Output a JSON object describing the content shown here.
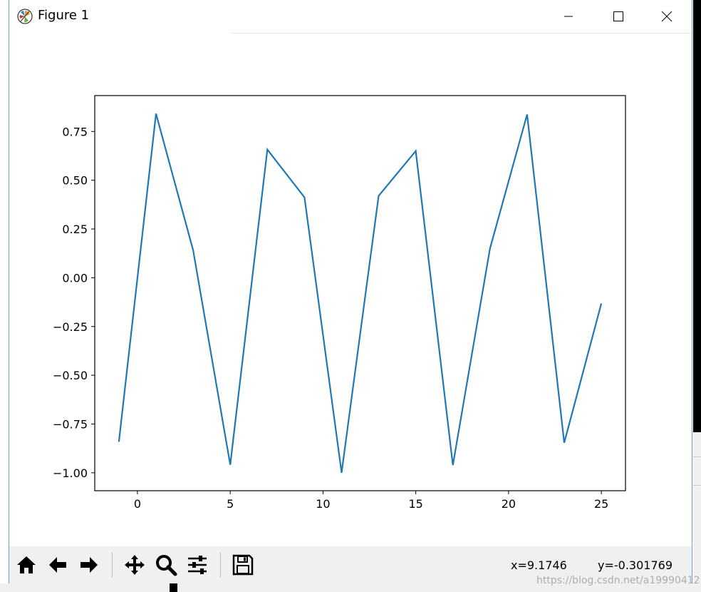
{
  "window": {
    "title": "Figure 1",
    "icons": {
      "app": "matplotlib-icon",
      "minimize": "minimize-icon",
      "maximize": "maximize-icon",
      "close": "close-icon"
    }
  },
  "toolbar": {
    "buttons": [
      {
        "name": "home",
        "icon": "home-icon"
      },
      {
        "name": "back",
        "icon": "arrow-left-icon"
      },
      {
        "name": "forward",
        "icon": "arrow-right-icon"
      },
      {
        "name": "pan",
        "icon": "move-icon"
      },
      {
        "name": "zoom",
        "icon": "zoom-icon"
      },
      {
        "name": "configure-subplots",
        "icon": "sliders-icon"
      },
      {
        "name": "save",
        "icon": "save-icon"
      }
    ],
    "x_readout": "x=9.1746",
    "y_readout": "y=-0.301769"
  },
  "watermark": "https://blog.csdn.net/a19990412",
  "chart_data": {
    "type": "line",
    "title": "",
    "xlabel": "",
    "ylabel": "",
    "xlim": [
      -2.3,
      26.3
    ],
    "ylim": [
      -1.092,
      0.934
    ],
    "xticks": [
      0,
      5,
      10,
      15,
      20,
      25
    ],
    "xtick_labels": [
      "0",
      "5",
      "10",
      "15",
      "20",
      "25"
    ],
    "yticks": [
      0.75,
      0.5,
      0.25,
      0.0,
      -0.25,
      -0.5,
      -0.75,
      -1.0
    ],
    "ytick_labels": [
      "0.75",
      "0.50",
      "0.25",
      "0.00",
      "−0.25",
      "−0.50",
      "−0.75",
      "−1.00"
    ],
    "grid": false,
    "series": [
      {
        "color": "#1f77b4",
        "x": [
          -1,
          1,
          3,
          5,
          7,
          9,
          11,
          13,
          15,
          17,
          19,
          21,
          23,
          25
        ],
        "y": [
          -0.841,
          0.841,
          0.141,
          -0.959,
          0.657,
          0.412,
          -1.0,
          0.42,
          0.65,
          -0.961,
          0.15,
          0.837,
          -0.846,
          -0.132
        ]
      }
    ]
  }
}
